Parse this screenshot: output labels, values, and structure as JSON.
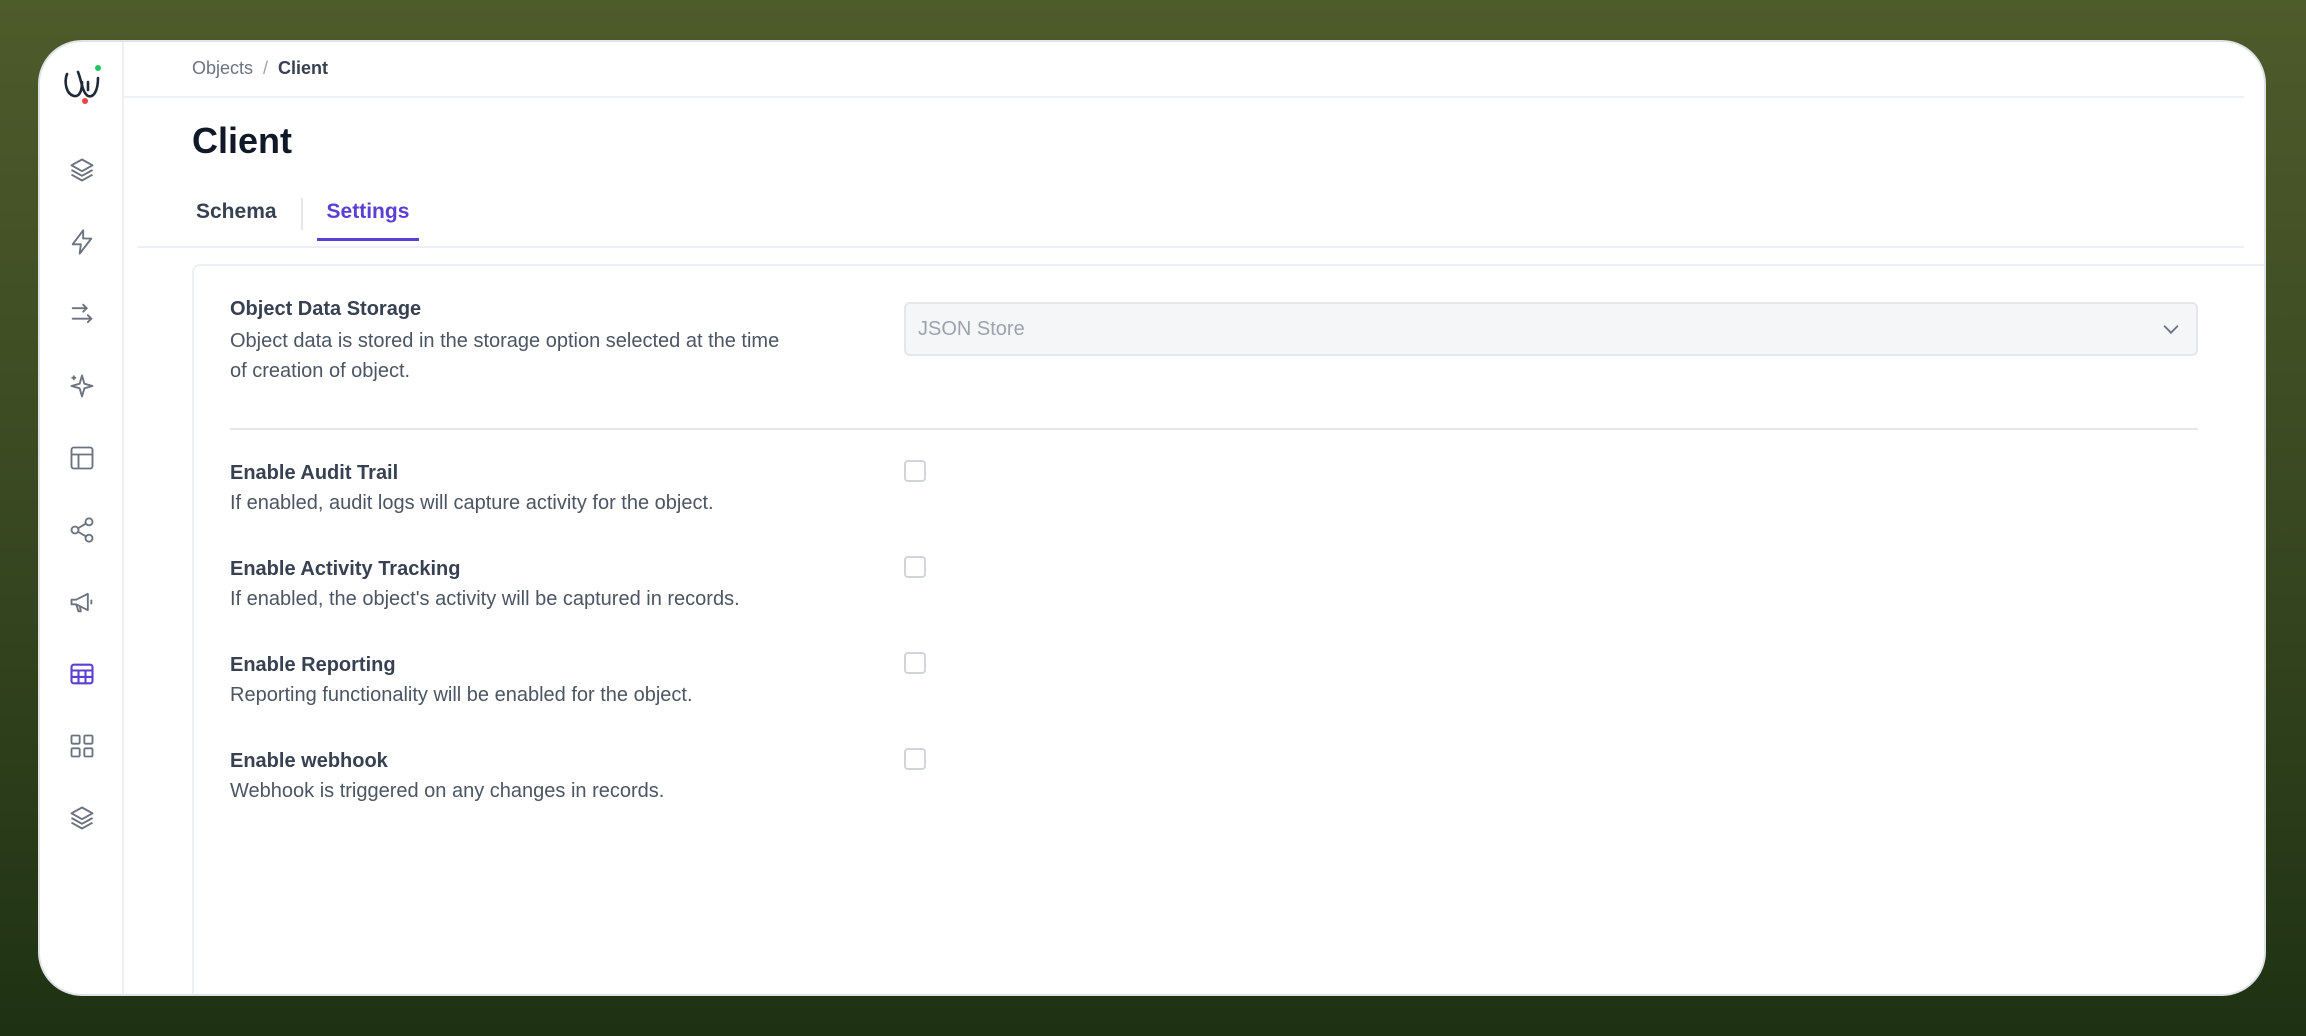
{
  "breadcrumb": {
    "root": "Objects",
    "separator": "/",
    "current": "Client"
  },
  "page": {
    "title": "Client"
  },
  "tabs": [
    {
      "label": "Schema",
      "active": false
    },
    {
      "label": "Settings",
      "active": true
    }
  ],
  "storage": {
    "label": "Object Data Storage",
    "description_line1": "Object data is stored in the storage option selected at the time",
    "description_line2": "of creation of object.",
    "select_value": "JSON Store"
  },
  "settings": [
    {
      "label": "Enable Audit Trail",
      "description": "If enabled, audit logs will capture activity for the object.",
      "checked": false
    },
    {
      "label": "Enable Activity Tracking",
      "description": "If enabled, the object's activity will be captured in records.",
      "checked": false
    },
    {
      "label": "Enable Reporting",
      "description": "Reporting functionality will be enabled for the object.",
      "checked": false
    },
    {
      "label": "Enable webhook",
      "description": "Webhook is triggered on any changes in records.",
      "checked": false
    }
  ],
  "sidebar_icons": [
    "layers-icon",
    "lightning-icon",
    "arrows-icon",
    "sparkles-icon",
    "layout-icon",
    "share-icon",
    "megaphone-icon",
    "table-icon",
    "grid-icon",
    "stack-icon"
  ],
  "colors": {
    "accent": "#5b3fd4",
    "background_top": "#4e5b2b",
    "background_bottom": "#1e3213"
  }
}
